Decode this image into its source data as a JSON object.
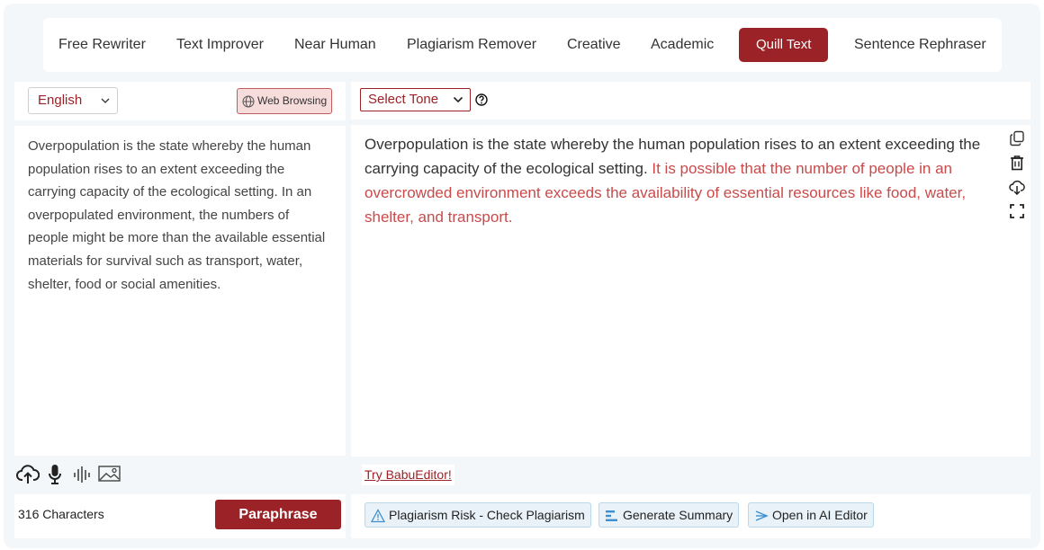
{
  "modes": [
    "Free Rewriter",
    "Text Improver",
    "Near Human",
    "Plagiarism Remover",
    "Creative",
    "Academic",
    "Quill Text",
    "Sentence Rephraser"
  ],
  "active_mode": "Quill Text",
  "input": {
    "language": "English",
    "web_browsing_label": "Web Browsing",
    "text": "Overpopulation is the state whereby the human population rises to an extent exceeding the carrying capacity of the ecological setting. In an overpopulated environment, the numbers of people might be more than the available essential materials for survival such as transport, water, shelter, food or social amenities.",
    "char_count": "316 Characters",
    "paraphrase_label": "Paraphrase",
    "tool_icons": [
      "upload-cloud-icon",
      "microphone-icon",
      "audio-wave-icon",
      "image-icon"
    ]
  },
  "output": {
    "tone_label": "Select Tone",
    "text_plain": "Overpopulation is the state whereby the human population rises to an extent exceeding the carrying capacity of the ecological setting. ",
    "text_changed": "It is possible that the number of people in an overcrowded environment exceeds the availability of essential resources like food, water, shelter, and transport.",
    "side_icons": [
      "copy-icon",
      "trash-icon",
      "download-cloud-icon",
      "fullscreen-icon"
    ],
    "try_link": "Try BabuEditor!",
    "actions": [
      "Plagiarism Risk - Check Plagiarism",
      "Generate Summary",
      "Open in AI Editor"
    ]
  },
  "colors": {
    "accent": "#9b2226",
    "changed_text": "#c94a4a",
    "action_bg": "#e8f2f8"
  }
}
